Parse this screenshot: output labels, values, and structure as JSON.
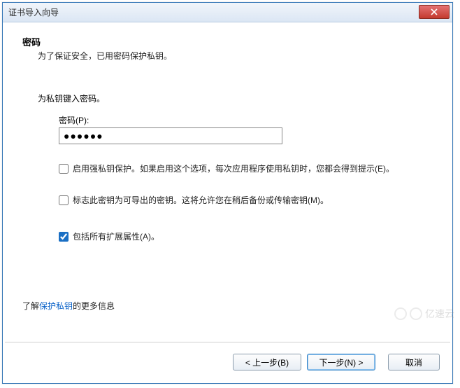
{
  "window": {
    "title": "证书导入向导"
  },
  "header": {
    "heading": "密码",
    "subheading": "为了保证安全，已用密码保护私钥。"
  },
  "form": {
    "prompt": "为私钥键入密码。",
    "password_label": "密码(P):",
    "password_value": "●●●●●●",
    "cb_strong": {
      "checked": false,
      "text": "启用强私钥保护。如果启用这个选项，每次应用程序使用私钥时，您都会得到提示(E)。"
    },
    "cb_exportable": {
      "checked": false,
      "text": "标志此密钥为可导出的密钥。这将允许您在稍后备份或传输密钥(M)。"
    },
    "cb_extended": {
      "checked": true,
      "text": "包括所有扩展属性(A)。"
    }
  },
  "footer": {
    "learn_prefix": "了解",
    "learn_link": "保护私钥",
    "learn_suffix": "的更多信息"
  },
  "buttons": {
    "back": "< 上一步(B)",
    "next": "下一步(N) >",
    "cancel": "取消"
  },
  "watermark": "亿速云"
}
